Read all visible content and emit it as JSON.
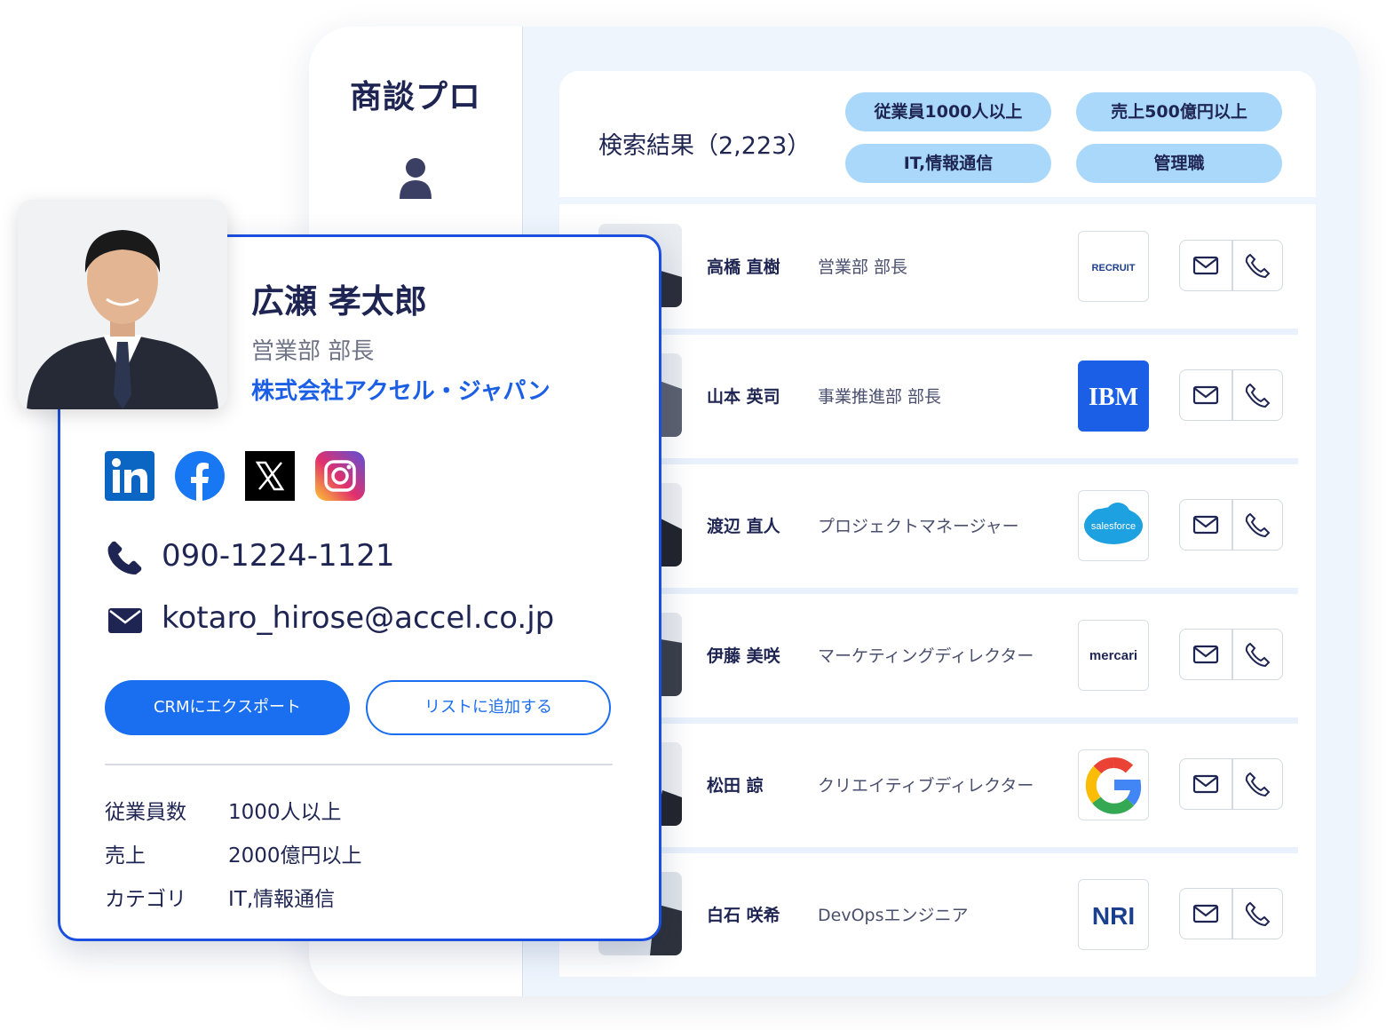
{
  "app": {
    "brand": "商談プロ"
  },
  "results": {
    "title": "検索結果（2,223）",
    "filters": [
      "従業員1000人以上",
      "売上500億円以上",
      "IT,情報通信",
      "管理職"
    ],
    "rows": [
      {
        "name": "高橋 直樹",
        "title": "営業部 部長",
        "company_logo": "RECRUIT"
      },
      {
        "name": "山本 英司",
        "title": "事業推進部 部長",
        "company_logo": "IBM"
      },
      {
        "name": "渡辺 直人",
        "title": "プロジェクトマネージャー",
        "company_logo": "salesforce"
      },
      {
        "name": "伊藤 美咲",
        "title": "マーケティングディレクター",
        "company_logo": "mercari"
      },
      {
        "name": "松田 諒",
        "title": "クリエイティブディレクター",
        "company_logo": "G"
      },
      {
        "name": "白石 咲希",
        "title": "DevOpsエンジニア",
        "company_logo": "NRI"
      }
    ]
  },
  "profile": {
    "name": "広瀬 孝太郎",
    "title": "営業部 部長",
    "company": "株式会社アクセル・ジャパン",
    "social": [
      "linkedin-icon",
      "facebook-icon",
      "x-icon",
      "instagram-icon"
    ],
    "phone": "090-1224-1121",
    "email": "kotaro_hirose@accel.co.jp",
    "export_button": "CRMにエクスポート",
    "add_list_button": "リストに追加する",
    "info": [
      {
        "label": "従業員数",
        "value": "1000人以上"
      },
      {
        "label": "売上",
        "value": "2000億円以上"
      },
      {
        "label": "カテゴリ",
        "value": "IT,情報通信"
      }
    ]
  },
  "colors": {
    "primary": "#1a6ef0",
    "card_border": "#1a4fe0",
    "chip": "#a9d8fb",
    "text_dark": "#1f2552",
    "app_bg": "#eef5fd"
  }
}
